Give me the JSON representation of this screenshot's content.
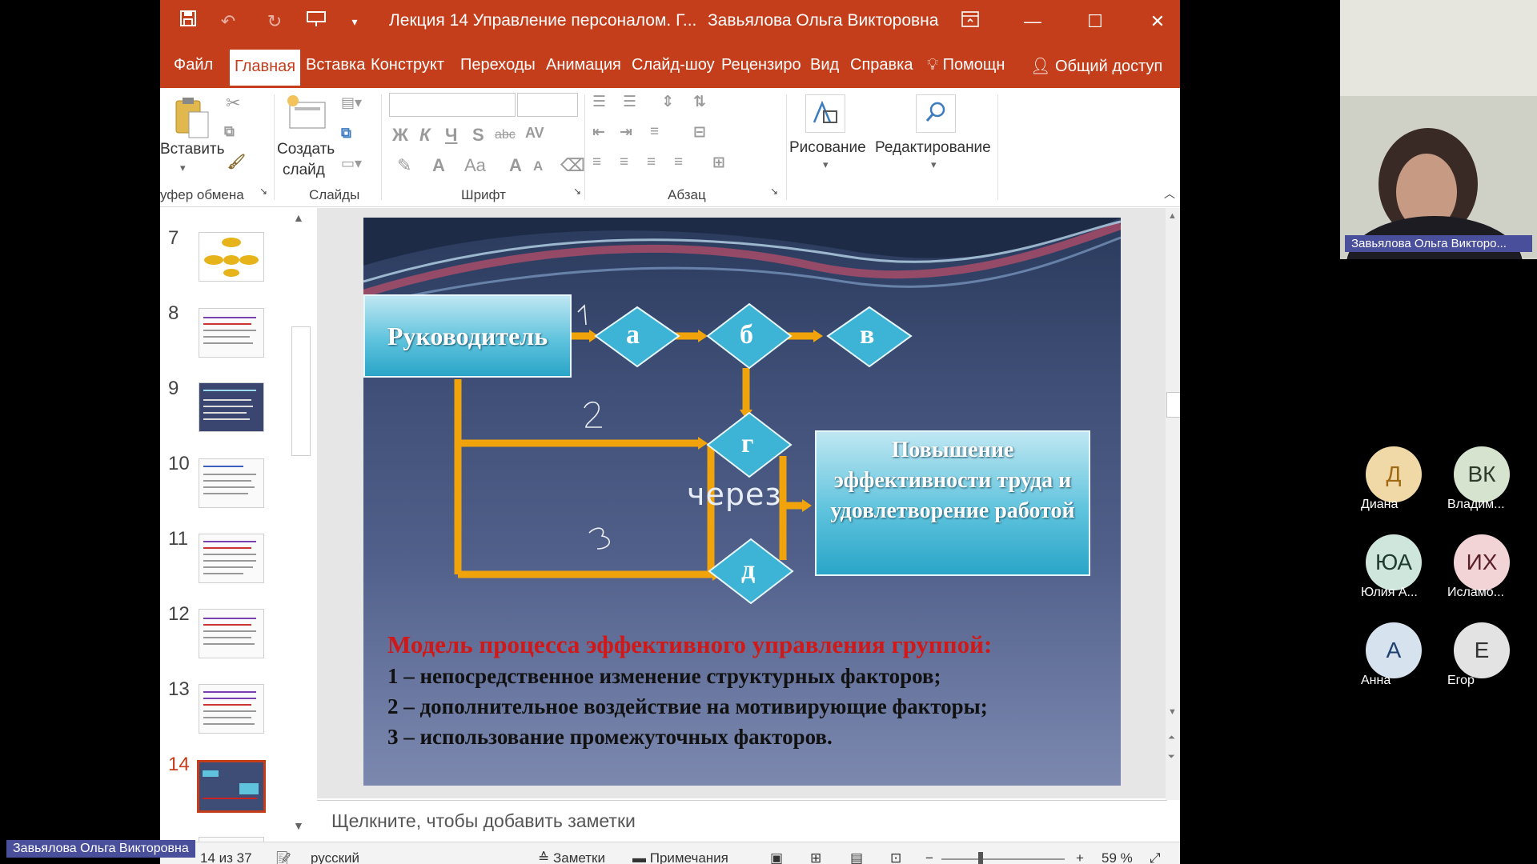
{
  "window": {
    "title": "Лекция 14 Управление персоналом. Г...",
    "user": "Завьялова Ольга Викторовна"
  },
  "tabs": [
    "Файл",
    "Главная",
    "Вставка",
    "Конструкт",
    "Переходы",
    "Анимация",
    "Слайд-шоу",
    "Рецензиро",
    "Вид",
    "Справка"
  ],
  "tab_help": "Помощн",
  "tab_share": "Общий доступ",
  "ribbon": {
    "paste": "Вставить",
    "new_slide_1": "Создать",
    "new_slide_2": "слайд",
    "drawing": "Рисование",
    "editing": "Редактирование",
    "group_clipboard": "уфер обмена",
    "group_slides": "Слайды",
    "group_font": "Шрифт",
    "group_paragraph": "Абзац",
    "bold": "Ж",
    "italic": "К",
    "underline": "Ч",
    "shadow": "S",
    "strike": "abc",
    "spacing": "AV",
    "fontcolor": "A",
    "case": "Aa",
    "grow": "A",
    "shrink": "A"
  },
  "thumbnails": [
    {
      "num": "7"
    },
    {
      "num": "8"
    },
    {
      "num": "9"
    },
    {
      "num": "10"
    },
    {
      "num": "11"
    },
    {
      "num": "12"
    },
    {
      "num": "13"
    },
    {
      "num": "14"
    }
  ],
  "slide": {
    "boss": "Руководитель",
    "a": "а",
    "b": "б",
    "v": "в",
    "g": "г",
    "d": "д",
    "result": "Повышение эффективности труда и удовлетворение работой",
    "hand_1": "1",
    "hand_2": "2",
    "hand_3": "3",
    "hand_via": "через",
    "model_title": "Модель процесса эффективного управления группой:",
    "line1": "1 – непосредственное изменение структурных факторов;",
    "line2": "2 – дополнительное воздействие на мотивирующие факторы;",
    "line3": "3 – использование промежуточных факторов."
  },
  "notes_placeholder": "Щелкните, чтобы добавить заметки",
  "status": {
    "slide_of": "14 из 37",
    "language": "русский",
    "notes": "Заметки",
    "comments": "Примечания",
    "zoom": "59 %"
  },
  "presenter_label": "Завьялова Ольга Викторовна",
  "video": {
    "name": "Завьялова Ольга Викторо..."
  },
  "participants": [
    {
      "initials": "Д",
      "name": "Диана",
      "color": "#f0d9a6",
      "fg": "#a06a14"
    },
    {
      "initials": "ВК",
      "name": "Владим...",
      "color": "#d6e3cf",
      "fg": "#2f3b2a"
    },
    {
      "initials": "ЮА",
      "name": "Юлия А...",
      "color": "#cfe6dc",
      "fg": "#1f3a30"
    },
    {
      "initials": "ИХ",
      "name": "Исламо...",
      "color": "#f2d3d6",
      "fg": "#5a2028"
    },
    {
      "initials": "А",
      "name": "Анна",
      "color": "#d7e2ef",
      "fg": "#1f3f6e"
    },
    {
      "initials": "Е",
      "name": "Егор",
      "color": "#e3e3e3",
      "fg": "#333333"
    }
  ]
}
